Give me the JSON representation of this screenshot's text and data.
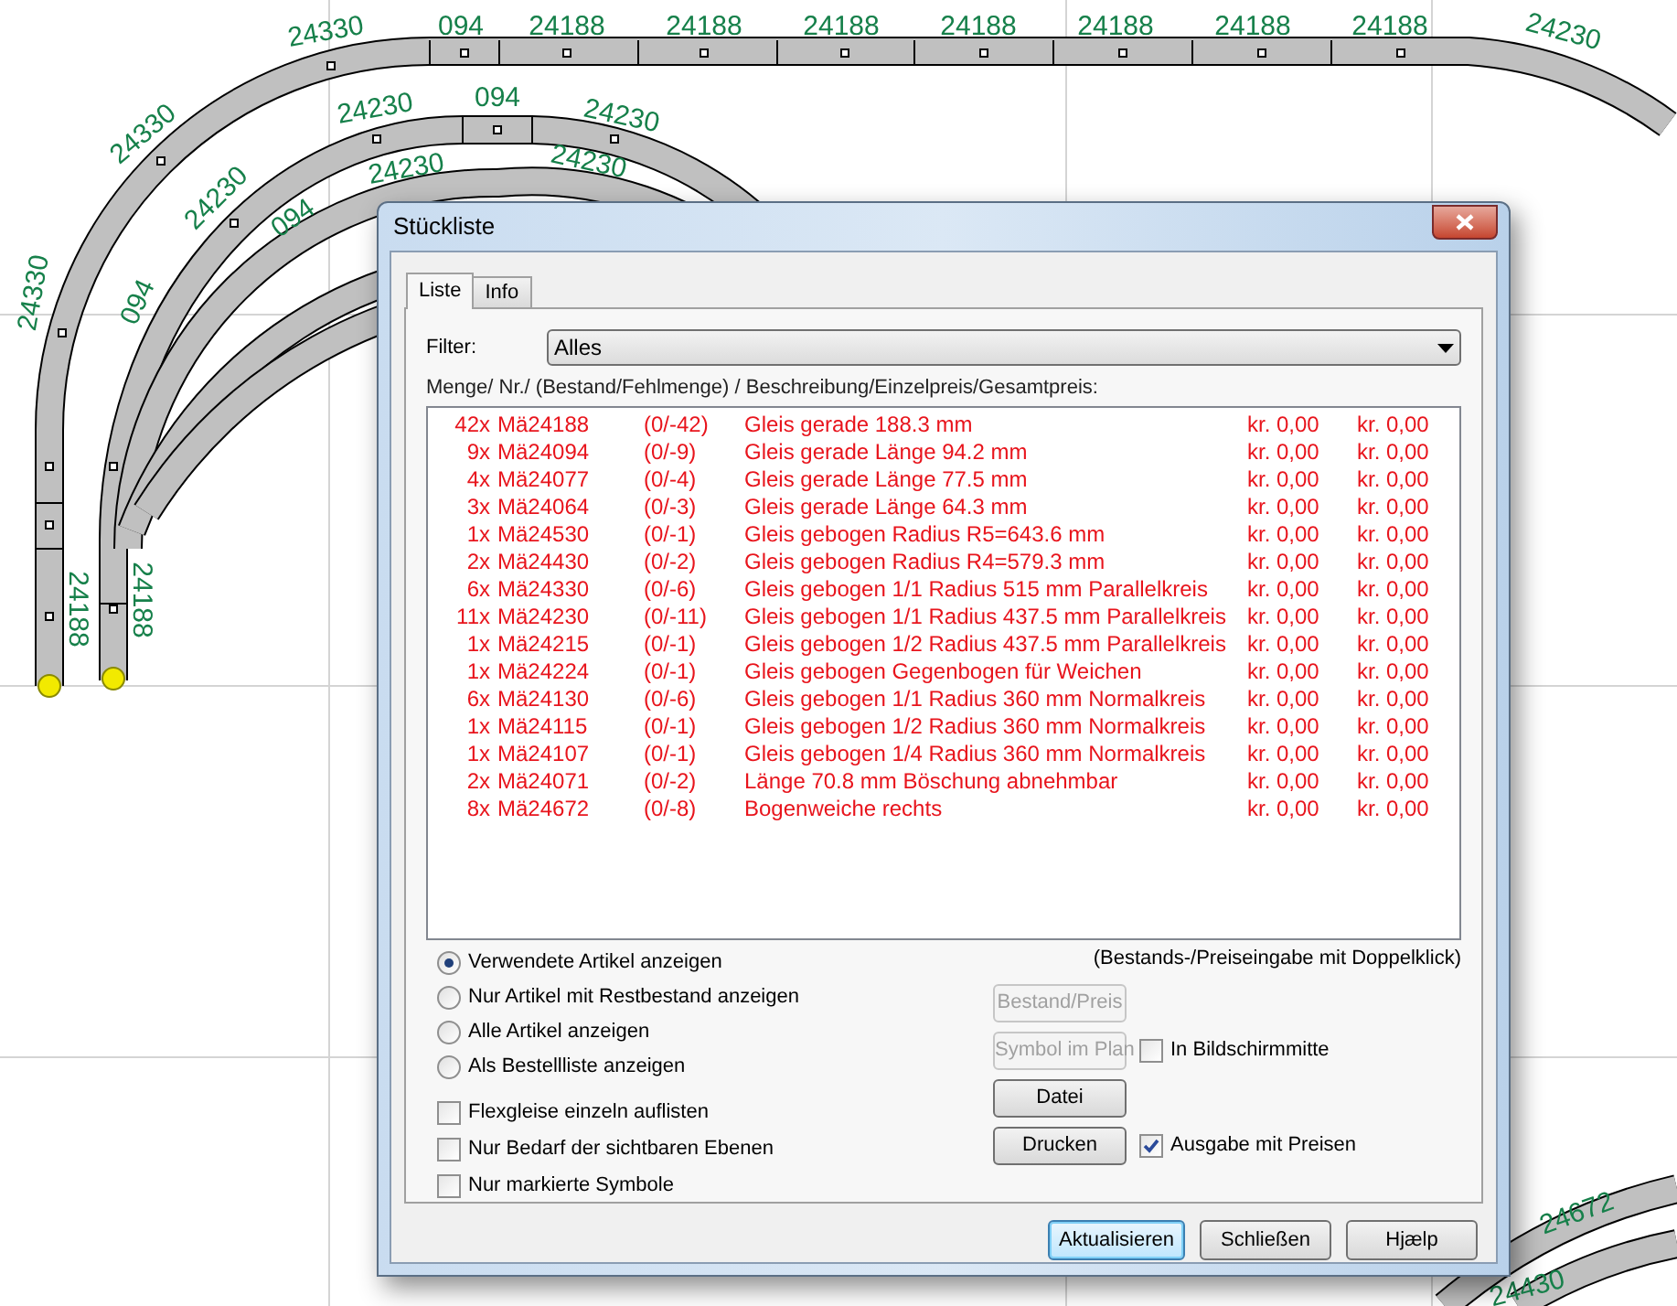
{
  "canvas": {
    "track_labels": [
      "24330",
      "094",
      "24188",
      "24188",
      "24188",
      "24188",
      "24188",
      "24188",
      "24188",
      "24230",
      "24330",
      "24330",
      "24230",
      "094",
      "24230",
      "24230",
      "24230",
      "24230",
      "094",
      "094",
      "24188",
      "24188",
      "24672",
      "24430"
    ]
  },
  "dialog": {
    "title": "Stückliste",
    "tabs": [
      {
        "label": "Liste",
        "selected": true
      },
      {
        "label": "Info",
        "selected": false
      }
    ],
    "filter": {
      "label": "Filter:",
      "value": "Alles"
    },
    "list_header": "Menge/ Nr./ (Bestand/Fehlmenge) / Beschreibung/Einzelpreis/Gesamtpreis:",
    "rows": [
      {
        "qty": "42x",
        "number": "Mä24188",
        "stock": "(0/-42)",
        "description": "Gleis gerade 188.3 mm",
        "unit_price": "kr. 0,00",
        "total": "kr. 0,00"
      },
      {
        "qty": "9x",
        "number": "Mä24094",
        "stock": "(0/-9)",
        "description": "Gleis gerade Länge 94.2 mm",
        "unit_price": "kr. 0,00",
        "total": "kr. 0,00"
      },
      {
        "qty": "4x",
        "number": "Mä24077",
        "stock": "(0/-4)",
        "description": "Gleis gerade Länge 77.5 mm",
        "unit_price": "kr. 0,00",
        "total": "kr. 0,00"
      },
      {
        "qty": "3x",
        "number": "Mä24064",
        "stock": "(0/-3)",
        "description": "Gleis gerade Länge 64.3 mm",
        "unit_price": "kr. 0,00",
        "total": "kr. 0,00"
      },
      {
        "qty": "1x",
        "number": "Mä24530",
        "stock": "(0/-1)",
        "description": "Gleis gebogen Radius R5=643.6 mm",
        "unit_price": "kr. 0,00",
        "total": "kr. 0,00"
      },
      {
        "qty": "2x",
        "number": "Mä24430",
        "stock": "(0/-2)",
        "description": "Gleis gebogen Radius R4=579.3 mm",
        "unit_price": "kr. 0,00",
        "total": "kr. 0,00"
      },
      {
        "qty": "6x",
        "number": "Mä24330",
        "stock": "(0/-6)",
        "description": "Gleis gebogen 1/1 Radius 515 mm Parallelkreis",
        "unit_price": "kr. 0,00",
        "total": "kr. 0,00"
      },
      {
        "qty": "11x",
        "number": "Mä24230",
        "stock": "(0/-11)",
        "description": "Gleis gebogen 1/1 Radius 437.5 mm Parallelkreis",
        "unit_price": "kr. 0,00",
        "total": "kr. 0,00"
      },
      {
        "qty": "1x",
        "number": "Mä24215",
        "stock": "(0/-1)",
        "description": "Gleis gebogen 1/2 Radius 437.5 mm Parallelkreis",
        "unit_price": "kr. 0,00",
        "total": "kr. 0,00"
      },
      {
        "qty": "1x",
        "number": "Mä24224",
        "stock": "(0/-1)",
        "description": "Gleis gebogen Gegenbogen für Weichen",
        "unit_price": "kr. 0,00",
        "total": "kr. 0,00"
      },
      {
        "qty": "6x",
        "number": "Mä24130",
        "stock": "(0/-6)",
        "description": "Gleis gebogen 1/1 Radius 360 mm Normalkreis",
        "unit_price": "kr. 0,00",
        "total": "kr. 0,00"
      },
      {
        "qty": "1x",
        "number": "Mä24115",
        "stock": "(0/-1)",
        "description": "Gleis gebogen 1/2 Radius 360 mm Normalkreis",
        "unit_price": "kr. 0,00",
        "total": "kr. 0,00"
      },
      {
        "qty": "1x",
        "number": "Mä24107",
        "stock": "(0/-1)",
        "description": "Gleis gebogen 1/4 Radius 360 mm Normalkreis",
        "unit_price": "kr. 0,00",
        "total": "kr. 0,00"
      },
      {
        "qty": "2x",
        "number": "Mä24071",
        "stock": "(0/-2)",
        "description": "Länge 70.8 mm Böschung abnehmbar",
        "unit_price": "kr. 0,00",
        "total": "kr. 0,00"
      },
      {
        "qty": "8x",
        "number": "Mä24672",
        "stock": "(0/-8)",
        "description": "Bogenweiche rechts",
        "unit_price": "kr. 0,00",
        "total": "kr. 0,00"
      }
    ],
    "hint": "(Bestands-/Preiseingabe mit Doppelklick)",
    "view_options": [
      {
        "label": "Verwendete Artikel anzeigen",
        "selected": true
      },
      {
        "label": "Nur Artikel mit Restbestand anzeigen",
        "selected": false
      },
      {
        "label": "Alle Artikel anzeigen",
        "selected": false
      },
      {
        "label": "Als Bestellliste anzeigen",
        "selected": false
      }
    ],
    "options": [
      {
        "label": "Flexgleise einzeln auflisten",
        "checked": false
      },
      {
        "label": "Nur Bedarf der sichtbaren Ebenen",
        "checked": false
      },
      {
        "label": "Nur markierte Symbole",
        "checked": false
      }
    ],
    "side_rows": [
      {
        "button": {
          "label": "Bestand/Preis",
          "disabled": true
        }
      },
      {
        "button": {
          "label": "Symbol im Plan",
          "disabled": true
        },
        "checkbox": {
          "label": "In Bildschirmmitte",
          "checked": false
        }
      },
      {
        "button": {
          "label": "Datei",
          "disabled": false
        }
      },
      {
        "button": {
          "label": "Drucken",
          "disabled": false
        },
        "checkbox": {
          "label": "Ausgabe mit Preisen",
          "checked": true
        }
      }
    ],
    "buttons": [
      {
        "label": "Aktualisieren",
        "focused": true
      },
      {
        "label": "Schließen",
        "focused": false
      },
      {
        "label": "Hjælp",
        "focused": false
      }
    ]
  }
}
